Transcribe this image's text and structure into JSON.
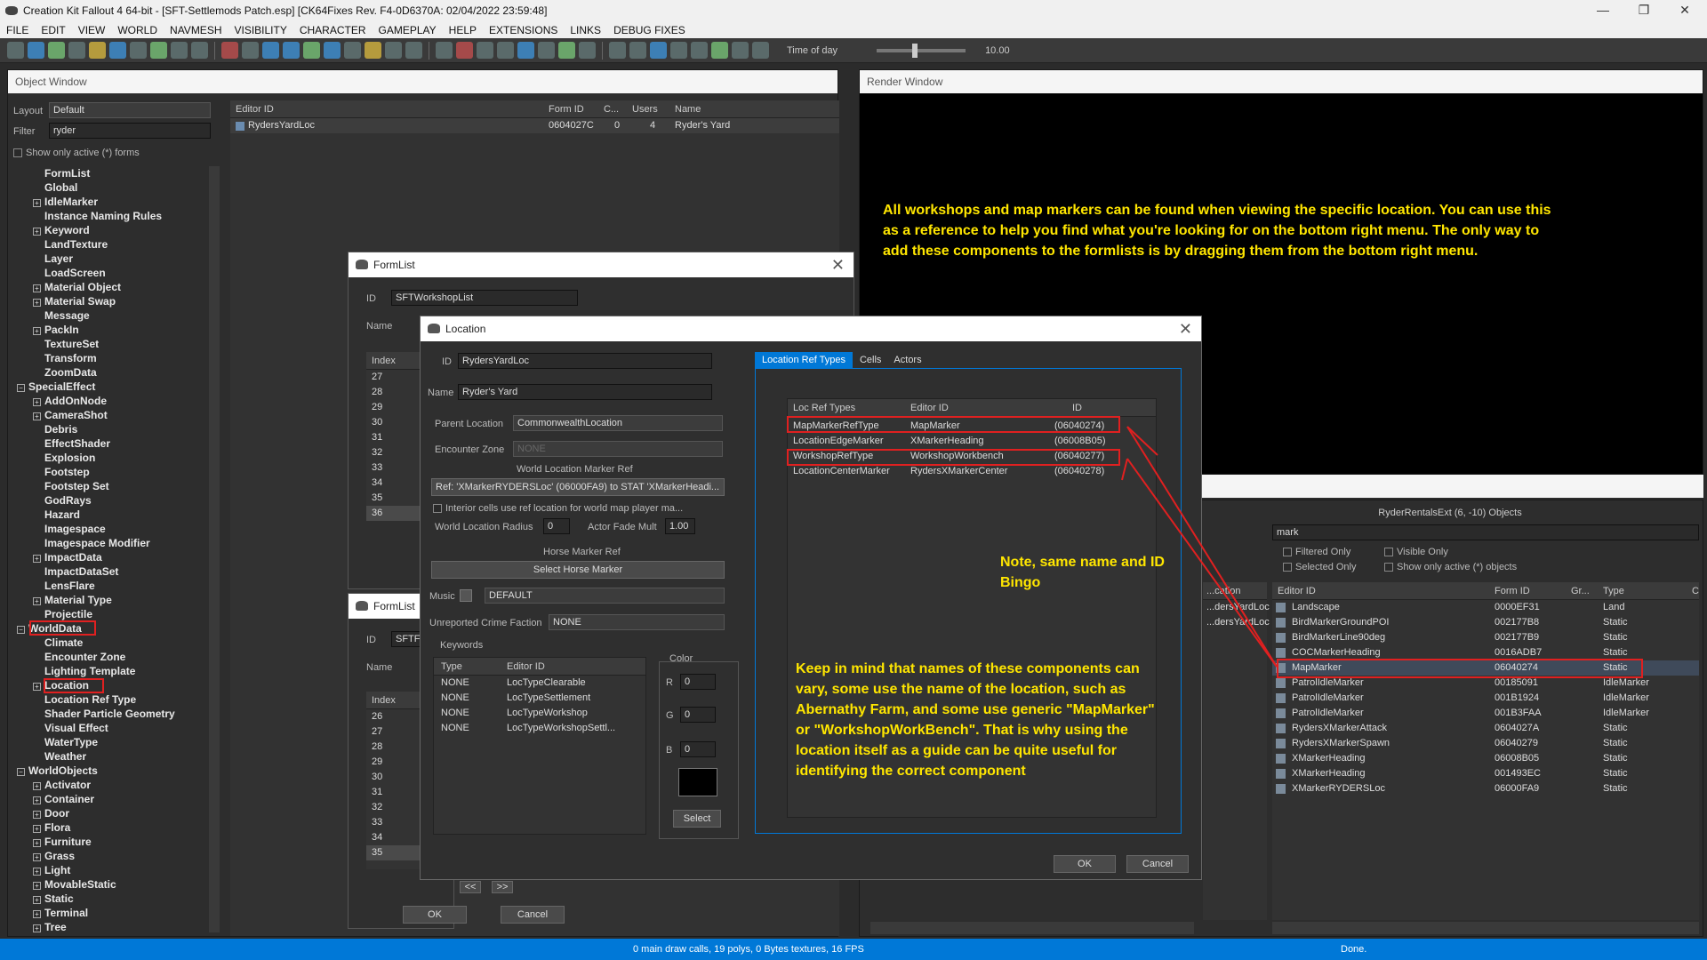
{
  "window": {
    "title": "Creation Kit Fallout 4 64-bit - [SFT-Settlemods Patch.esp] [CK64Fixes Rev. F4-0D6370A: 02/04/2022 23:59:48]",
    "min": "—",
    "max": "❐",
    "close": "✕"
  },
  "menu": [
    "FILE",
    "EDIT",
    "VIEW",
    "WORLD",
    "NAVMESH",
    "VISIBILITY",
    "CHARACTER",
    "GAMEPLAY",
    "HELP",
    "EXTENSIONS",
    "LINKS",
    "DEBUG FIXES"
  ],
  "toolbar": {
    "time_label": "Time of day",
    "time_value": "10.00",
    "time_fraction": 0.42
  },
  "object_window": {
    "title": "Object Window",
    "layout_label": "Layout",
    "layout_value": "Default",
    "filter_label": "Filter",
    "filter_value": "ryder",
    "show_active": "Show only active (*) forms",
    "columns": [
      "Editor ID",
      "Form ID",
      "C...",
      "Users",
      "Name"
    ],
    "row": {
      "editor_id": "RydersYardLoc",
      "form_id": "0604027C",
      "c": "0",
      "users": "4",
      "name": "Ryder's Yard"
    },
    "tree": [
      {
        "t": "FormList",
        "l": 1,
        "e": ""
      },
      {
        "t": "Global",
        "l": 1,
        "e": ""
      },
      {
        "t": "IdleMarker",
        "l": 1,
        "e": "+"
      },
      {
        "t": "Instance Naming Rules",
        "l": 1,
        "e": ""
      },
      {
        "t": "Keyword",
        "l": 1,
        "e": "+"
      },
      {
        "t": "LandTexture",
        "l": 1,
        "e": ""
      },
      {
        "t": "Layer",
        "l": 1,
        "e": ""
      },
      {
        "t": "LoadScreen",
        "l": 1,
        "e": ""
      },
      {
        "t": "Material Object",
        "l": 1,
        "e": "+"
      },
      {
        "t": "Material Swap",
        "l": 1,
        "e": "+"
      },
      {
        "t": "Message",
        "l": 1,
        "e": ""
      },
      {
        "t": "PackIn",
        "l": 1,
        "e": "+"
      },
      {
        "t": "TextureSet",
        "l": 1,
        "e": ""
      },
      {
        "t": "Transform",
        "l": 1,
        "e": ""
      },
      {
        "t": "ZoomData",
        "l": 1,
        "e": ""
      },
      {
        "t": "SpecialEffect",
        "l": 0,
        "e": "-"
      },
      {
        "t": "AddOnNode",
        "l": 1,
        "e": "+"
      },
      {
        "t": "CameraShot",
        "l": 1,
        "e": "+"
      },
      {
        "t": "Debris",
        "l": 1,
        "e": ""
      },
      {
        "t": "EffectShader",
        "l": 1,
        "e": ""
      },
      {
        "t": "Explosion",
        "l": 1,
        "e": ""
      },
      {
        "t": "Footstep",
        "l": 1,
        "e": ""
      },
      {
        "t": "Footstep Set",
        "l": 1,
        "e": ""
      },
      {
        "t": "GodRays",
        "l": 1,
        "e": ""
      },
      {
        "t": "Hazard",
        "l": 1,
        "e": ""
      },
      {
        "t": "Imagespace",
        "l": 1,
        "e": ""
      },
      {
        "t": "Imagespace Modifier",
        "l": 1,
        "e": ""
      },
      {
        "t": "ImpactData",
        "l": 1,
        "e": "+"
      },
      {
        "t": "ImpactDataSet",
        "l": 1,
        "e": ""
      },
      {
        "t": "LensFlare",
        "l": 1,
        "e": ""
      },
      {
        "t": "Material Type",
        "l": 1,
        "e": "+"
      },
      {
        "t": "Projectile",
        "l": 1,
        "e": ""
      },
      {
        "t": "WorldData",
        "l": 0,
        "e": "-"
      },
      {
        "t": "Climate",
        "l": 1,
        "e": ""
      },
      {
        "t": "Encounter Zone",
        "l": 1,
        "e": ""
      },
      {
        "t": "Lighting Template",
        "l": 1,
        "e": ""
      },
      {
        "t": "Location",
        "l": 1,
        "e": "+"
      },
      {
        "t": "Location Ref Type",
        "l": 1,
        "e": ""
      },
      {
        "t": "Shader Particle Geometry",
        "l": 1,
        "e": ""
      },
      {
        "t": "Visual Effect",
        "l": 1,
        "e": ""
      },
      {
        "t": "WaterType",
        "l": 1,
        "e": ""
      },
      {
        "t": "Weather",
        "l": 1,
        "e": ""
      },
      {
        "t": "WorldObjects",
        "l": 0,
        "e": "-"
      },
      {
        "t": "Activator",
        "l": 1,
        "e": "+"
      },
      {
        "t": "Container",
        "l": 1,
        "e": "+"
      },
      {
        "t": "Door",
        "l": 1,
        "e": "+"
      },
      {
        "t": "Flora",
        "l": 1,
        "e": "+"
      },
      {
        "t": "Furniture",
        "l": 1,
        "e": "+"
      },
      {
        "t": "Grass",
        "l": 1,
        "e": "+"
      },
      {
        "t": "Light",
        "l": 1,
        "e": "+"
      },
      {
        "t": "MovableStatic",
        "l": 1,
        "e": "+"
      },
      {
        "t": "Static",
        "l": 1,
        "e": "+"
      },
      {
        "t": "Terminal",
        "l": 1,
        "e": "+"
      },
      {
        "t": "Tree",
        "l": 1,
        "e": "+"
      }
    ]
  },
  "render_window": {
    "title": "Render Window",
    "note": "All workshops and map markers can be found when viewing the specific location. You can use this as a reference to help you find what you're looking for on the bottom right menu. The only way to add these components to the formlists is by dragging them from the bottom right menu."
  },
  "formlist1": {
    "title": "FormList",
    "id_label": "ID",
    "id_value": "SFTWorkshopList",
    "name_label": "Name",
    "index_label": "Index",
    "indices": [
      "27",
      "28",
      "29",
      "30",
      "31",
      "32",
      "33",
      "34",
      "35",
      "36"
    ]
  },
  "formlist2": {
    "title": "FormList",
    "id_label": "ID",
    "id_value": "SFTF",
    "name_label": "Name",
    "index_label": "Index",
    "indices": [
      "26",
      "27",
      "28",
      "29",
      "30",
      "31",
      "32",
      "33",
      "34",
      "35"
    ],
    "ok": "OK",
    "cancel": "Cancel"
  },
  "location": {
    "title": "Location",
    "id_label": "ID",
    "id_value": "RydersYardLoc",
    "name_label": "Name",
    "name_value": "Ryder's Yard",
    "parent_label": "Parent Location",
    "parent_value": "CommonwealthLocation",
    "enc_label": "Encounter Zone",
    "enc_value": "NONE",
    "wlmr_label": "World Location Marker Ref",
    "wlmr_value": "Ref: 'XMarkerRYDERSLoc' (06000FA9) to STAT 'XMarkerHeadi...",
    "interior_label": "Interior cells use ref location for world map player ma...",
    "radius_label": "World Location Radius",
    "radius_value": "0",
    "fade_label": "Actor Fade Mult",
    "fade_value": "1.00",
    "horse_label": "Horse Marker Ref",
    "horse_btn": "Select Horse Marker",
    "music_label": "Music",
    "music_value": "DEFAULT",
    "crime_label": "Unreported Crime Faction",
    "crime_value": "NONE",
    "keywords_label": "Keywords",
    "kw_cols": [
      "Type",
      "Editor ID"
    ],
    "keywords": [
      {
        "type": "NONE",
        "id": "LocTypeClearable"
      },
      {
        "type": "NONE",
        "id": "LocTypeSettlement"
      },
      {
        "type": "NONE",
        "id": "LocTypeWorkshop"
      },
      {
        "type": "NONE",
        "id": "LocTypeWorkshopSettl..."
      }
    ],
    "color_label": "Color",
    "r": "R",
    "g": "G",
    "b": "B",
    "rv": "0",
    "gv": "0",
    "bv": "0",
    "select": "Select",
    "tabs": [
      "Location Ref Types",
      "Cells",
      "Actors"
    ],
    "ref_cols": [
      "Loc Ref Types",
      "Editor ID",
      "ID"
    ],
    "refs": [
      {
        "type": "MapMarkerRefType",
        "id": "MapMarker",
        "fid": "(06040274)"
      },
      {
        "type": "LocationEdgeMarker",
        "id": "XMarkerHeading",
        "fid": "(06008B05)"
      },
      {
        "type": "WorkshopRefType",
        "id": "WorkshopWorkbench",
        "fid": "(06040277)"
      },
      {
        "type": "LocationCenterMarker",
        "id": "RydersXMarkerCenter",
        "fid": "(06040278)"
      }
    ],
    "note1": "Note, same name and ID Bingo",
    "note2": "Keep in mind that names of these components can vary, some use the name of the location, such as Abernathy Farm, and some use generic \"MapMarker\" or \"WorkshopWorkBench\". That is why using the location itself as a guide can be quite useful for identifying the correct component",
    "ok": "OK",
    "cancel": "Cancel",
    "prev": "<<",
    "next": ">>"
  },
  "cell_view": {
    "title": "RyderRentalsExt (6, -10) Objects",
    "filter": "mark",
    "filtered_only": "Filtered Only",
    "visible_only": "Visible Only",
    "selected_only": "Selected Only",
    "show_active": "Show only active (*) objects",
    "left_col": "...cation",
    "left_rows": [
      "...dersYardLoc",
      "...dersYardLoc"
    ],
    "cols": [
      "Editor ID",
      "Form ID",
      "Gr...",
      "Type",
      "C"
    ],
    "rows": [
      {
        "id": "Landscape",
        "fid": "0000EF31",
        "type": "Land"
      },
      {
        "id": "BirdMarkerGroundPOI",
        "fid": "002177B8",
        "type": "Static"
      },
      {
        "id": "BirdMarkerLine90deg",
        "fid": "002177B9",
        "type": "Static"
      },
      {
        "id": "COCMarkerHeading",
        "fid": "0016ADB7",
        "type": "Static"
      },
      {
        "id": "MapMarker",
        "fid": "06040274",
        "type": "Static"
      },
      {
        "id": "PatrolIdleMarker",
        "fid": "00185091",
        "type": "IdleMarker"
      },
      {
        "id": "PatrolIdleMarker",
        "fid": "001B1924",
        "type": "IdleMarker"
      },
      {
        "id": "PatrolIdleMarker",
        "fid": "001B3FAA",
        "type": "IdleMarker"
      },
      {
        "id": "RydersXMarkerAttack",
        "fid": "0604027A",
        "type": "Static"
      },
      {
        "id": "RydersXMarkerSpawn",
        "fid": "06040279",
        "type": "Static"
      },
      {
        "id": "XMarkerHeading",
        "fid": "06008B05",
        "type": "Static"
      },
      {
        "id": "XMarkerHeading",
        "fid": "001493EC",
        "type": "Static"
      },
      {
        "id": "XMarkerRYDERSLoc",
        "fid": "06000FA9",
        "type": "Static"
      }
    ]
  },
  "status": {
    "center": "0 main draw calls, 19 polys, 0 Bytes textures, 16 FPS",
    "right": "Done."
  }
}
